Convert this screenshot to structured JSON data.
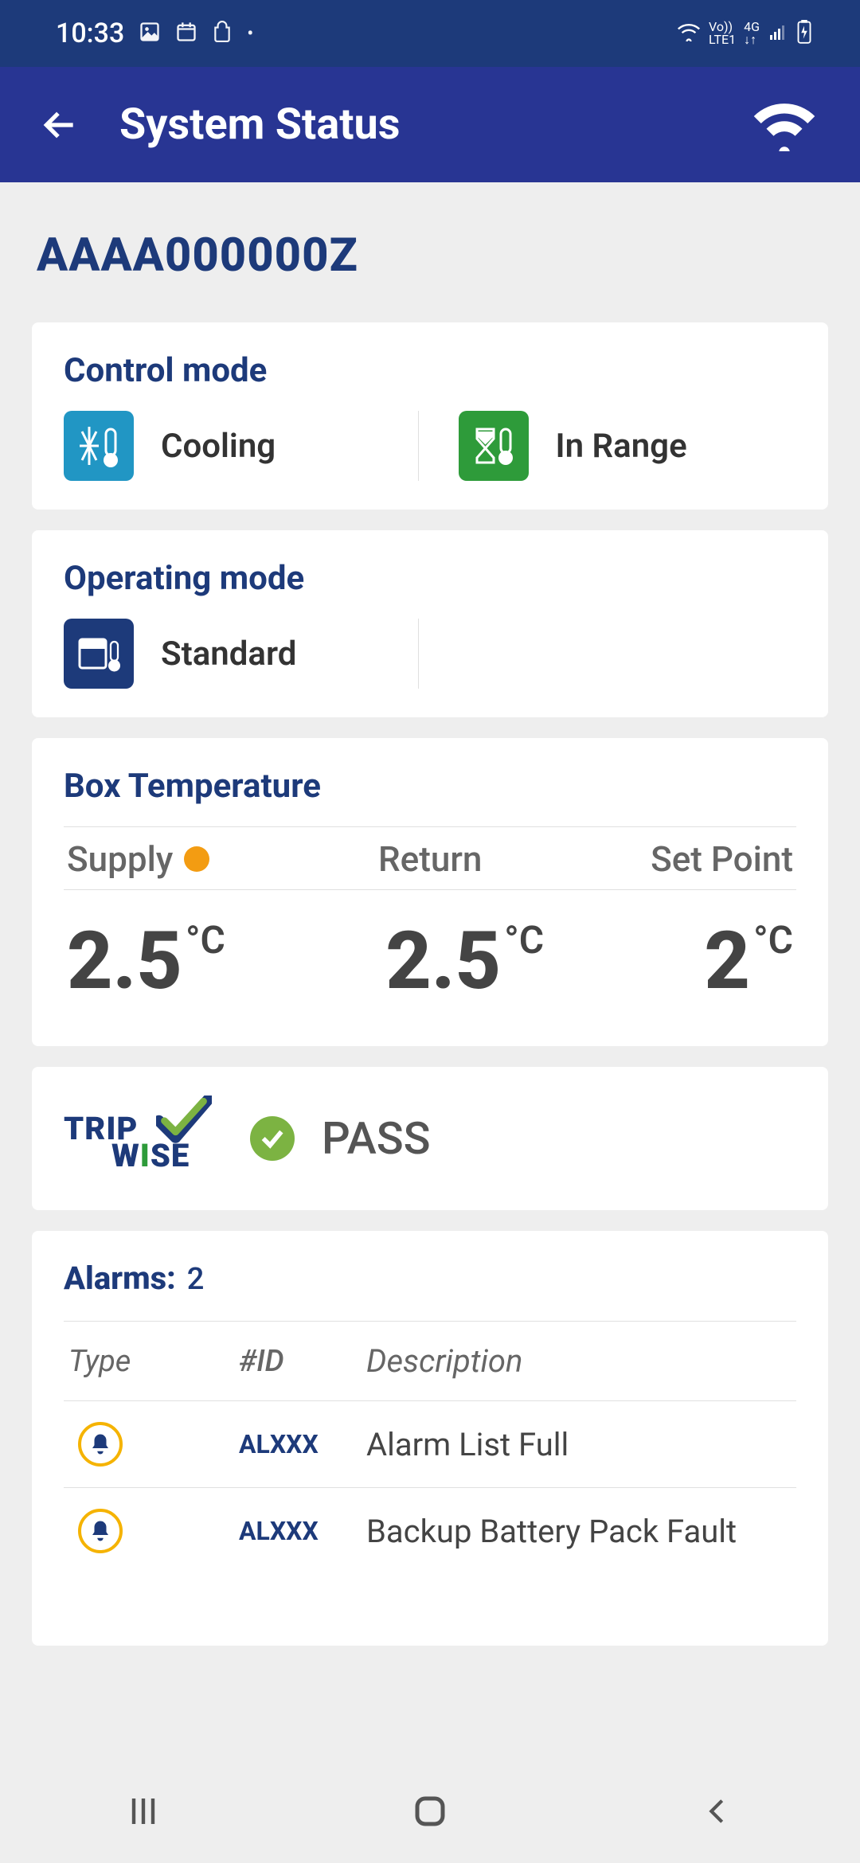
{
  "status": {
    "time": "10:33",
    "net1": "Vo))",
    "net2": "LTE1",
    "net3": "4G"
  },
  "header": {
    "title": "System Status"
  },
  "device": {
    "id": "AAAA000000Z"
  },
  "control_mode": {
    "heading": "Control mode",
    "left_label": "Cooling",
    "right_label": "In Range"
  },
  "operating_mode": {
    "heading": "Operating mode",
    "label": "Standard"
  },
  "box_temp": {
    "heading": "Box Temperature",
    "supply_label": "Supply",
    "return_label": "Return",
    "setpoint_label": "Set Point",
    "supply_value": "2.5",
    "return_value": "2.5",
    "setpoint_value": "2",
    "unit": "°C"
  },
  "tripwise": {
    "brand_a": "TRIP",
    "brand_b_pre": "W",
    "brand_b_i": "I",
    "brand_b_post": "SE",
    "status": "PASS"
  },
  "alarms": {
    "heading": "Alarms:",
    "count": "2",
    "hd_type": "Type",
    "hd_id": "#ID",
    "hd_desc": "Description",
    "rows": [
      {
        "id": "ALXXX",
        "desc": "Alarm List Full"
      },
      {
        "id": "ALXXX",
        "desc": "Backup Battery Pack Fault"
      }
    ]
  }
}
